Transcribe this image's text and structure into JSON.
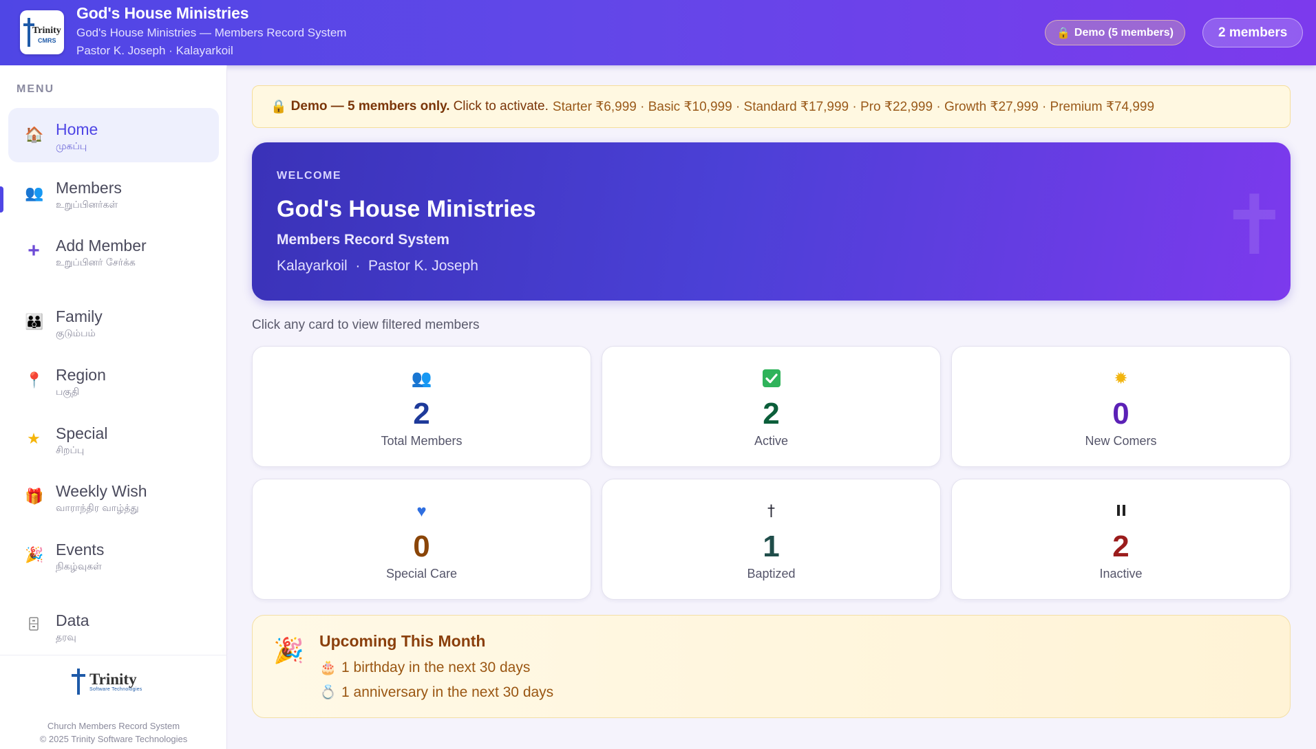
{
  "header": {
    "title": "God's House Ministries",
    "subtitle": "God's House Ministries — Members Record System",
    "pastor_line": "Pastor K. Joseph · Kalayarkoil",
    "demo_badge": "Demo (5 members)",
    "members_badge": "2 members",
    "logo_text_top": "Trinity",
    "logo_text_bottom": "CMRS"
  },
  "sidebar": {
    "menu_heading": "MENU",
    "items": [
      {
        "label": "Home",
        "sub": "முகப்பு",
        "icon": "home-icon",
        "active": true
      },
      {
        "label": "Members",
        "sub": "உறுப்பினர்கள்",
        "icon": "members-icon"
      },
      {
        "label": "Add Member",
        "sub": "உறுப்பினர் சேர்க்க",
        "icon": "plus-icon"
      },
      {
        "label": "Family",
        "sub": "குடும்பம்",
        "icon": "family-icon"
      },
      {
        "label": "Region",
        "sub": "பகுதி",
        "icon": "pin-icon"
      },
      {
        "label": "Special",
        "sub": "சிறப்பு",
        "icon": "star-icon"
      },
      {
        "label": "Weekly Wish",
        "sub": "வாராந்திர வாழ்த்து",
        "icon": "gift-icon"
      },
      {
        "label": "Events",
        "sub": "நிகழ்வுகள்",
        "icon": "party-icon"
      },
      {
        "label": "Data",
        "sub": "தரவு",
        "icon": "cabinet-icon"
      }
    ],
    "footer": {
      "brand": "Trinity",
      "brand_sub": "Software Technologies",
      "line1": "Church Members Record System",
      "line2": "© 2025 Trinity Software Technologies"
    }
  },
  "banner": {
    "lead": "Demo — 5 members only.",
    "action": "Click to activate.",
    "prices": "Starter ₹6,999 · Basic ₹10,999 · Standard ₹17,999 · Pro ₹22,999 · Growth ₹27,999 · Premium ₹74,999"
  },
  "welcome": {
    "kicker": "WELCOME",
    "title": "God's House Ministries",
    "subtitle": "Members Record System",
    "location": "Kalayarkoil  ·  Pastor K. Joseph"
  },
  "hint": "Click any card to view filtered members",
  "stats": [
    {
      "value": "2",
      "label": "Total Members",
      "icon": "members-icon",
      "color": "#1e3a9a"
    },
    {
      "value": "2",
      "label": "Active",
      "icon": "check-icon",
      "color": "#0b5e3a"
    },
    {
      "value": "0",
      "label": "New Comers",
      "icon": "sparkle-icon",
      "color": "#5b21b6"
    },
    {
      "value": "0",
      "label": "Special Care",
      "icon": "heart-icon",
      "color": "#8a4508"
    },
    {
      "value": "1",
      "label": "Baptized",
      "icon": "cross-icon",
      "color": "#1f4d4a"
    },
    {
      "value": "2",
      "label": "Inactive",
      "icon": "pause-icon",
      "color": "#9b1c1c"
    }
  ],
  "upcoming": {
    "title": "Upcoming This Month",
    "birthday": "1 birthday in the next 30 days",
    "anniversary": "1 anniversary in the next 30 days"
  }
}
